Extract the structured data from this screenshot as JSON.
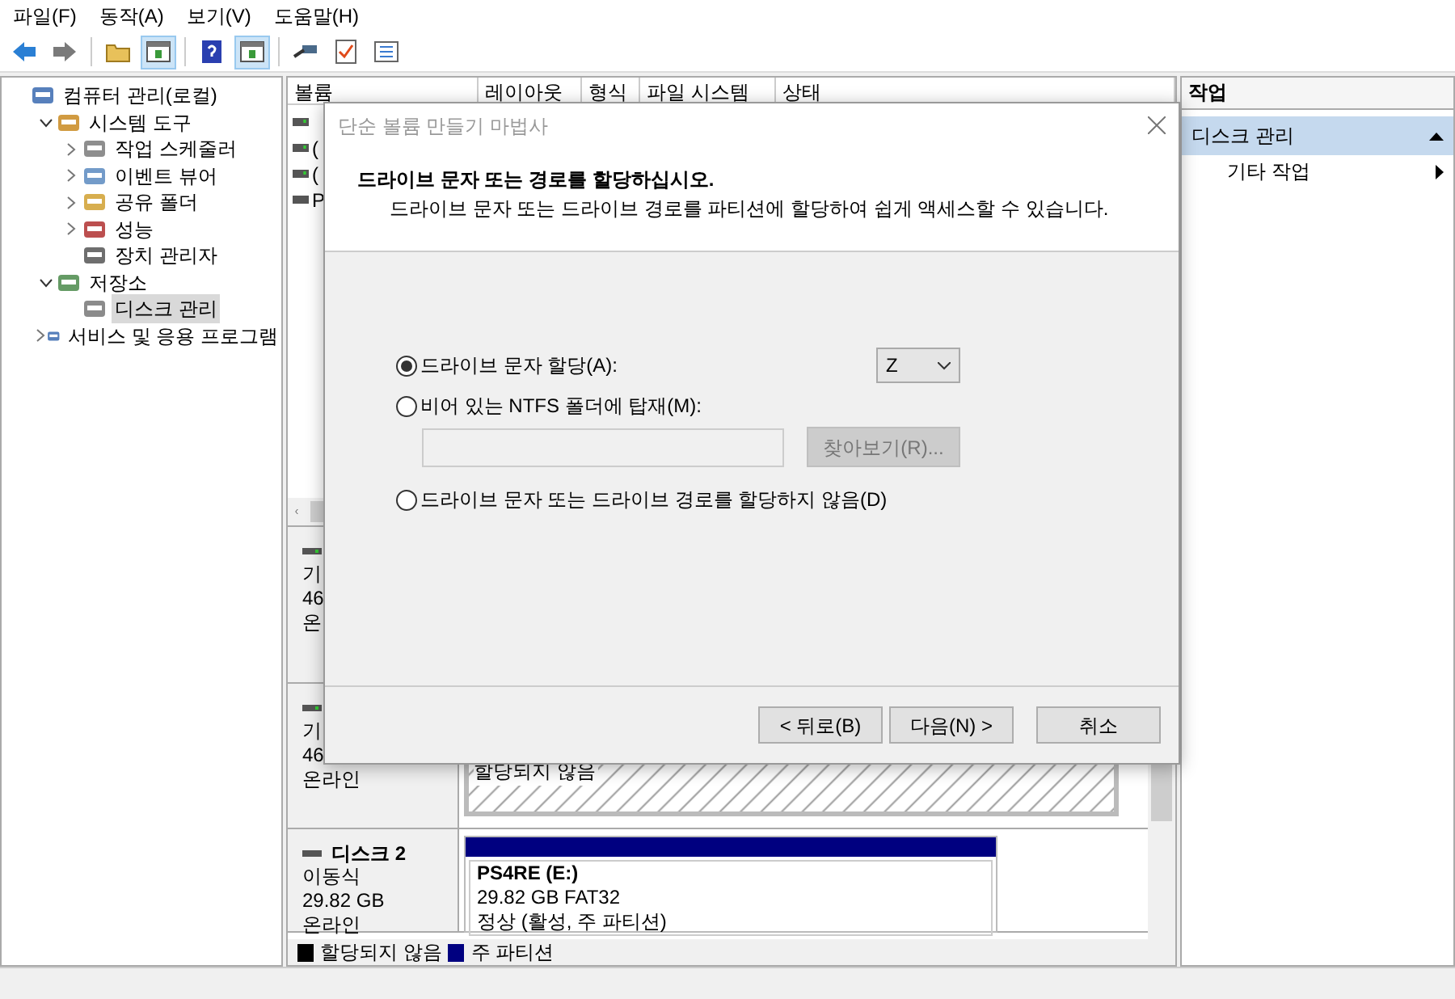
{
  "menu": [
    "파일(F)",
    "동작(A)",
    "보기(V)",
    "도움말(H)"
  ],
  "toolbar": [
    {
      "kind": "back",
      "pressed": false
    },
    {
      "kind": "forward",
      "pressed": false
    },
    {
      "kind": "sep"
    },
    {
      "kind": "folder",
      "pressed": false
    },
    {
      "kind": "pane",
      "pressed": true
    },
    {
      "kind": "sep"
    },
    {
      "kind": "help",
      "pressed": false
    },
    {
      "kind": "pane",
      "pressed": true
    },
    {
      "kind": "sep"
    },
    {
      "kind": "plug",
      "pressed": false
    },
    {
      "kind": "check",
      "pressed": false
    },
    {
      "kind": "list",
      "pressed": false
    }
  ],
  "tree": {
    "label": "컴퓨터 관리(로컬)",
    "children": [
      {
        "label": "시스템 도구",
        "expanded": true,
        "selected": false,
        "children": [
          {
            "label": "작업 스케줄러",
            "expanded": false,
            "selected": false
          },
          {
            "label": "이벤트 뷰어",
            "expanded": false,
            "selected": false
          },
          {
            "label": "공유 폴더",
            "expanded": false,
            "selected": false
          },
          {
            "label": "성능",
            "expanded": false,
            "selected": false
          },
          {
            "label": "장치 관리자",
            "selected": false
          }
        ]
      },
      {
        "label": "저장소",
        "expanded": true,
        "selected": false,
        "children": [
          {
            "label": "디스크 관리",
            "selected": true
          }
        ]
      },
      {
        "label": "서비스 및 응용 프로그램",
        "expanded": false,
        "selected": false
      }
    ]
  },
  "volume_table": {
    "columns": [
      "볼륨",
      "레이아웃",
      "형식",
      "파일 시스템",
      "상태"
    ],
    "rows": [
      {
        "column_1": ""
      },
      {
        "column_1": "("
      },
      {
        "column_1": "("
      },
      {
        "column_1": "P"
      }
    ]
  },
  "disks": [
    {
      "lines": [
        "기",
        "46",
        "온"
      ]
    },
    {
      "lines": [
        "기",
        "46",
        "온라인"
      ],
      "partitions": [
        {
          "kind": "unallocated",
          "lines": [
            "할당되지 않음"
          ]
        }
      ]
    },
    {
      "title": "디스크 2",
      "lines": [
        "이동식",
        "29.82 GB",
        "온라인"
      ],
      "partitions": [
        {
          "kind": "primary",
          "name": "PS4RE  (E:)",
          "lines": [
            "29.82 GB FAT32",
            "정상 (활성, 주 파티션)"
          ]
        }
      ]
    }
  ],
  "legend": [
    {
      "label": "할당되지 않음",
      "color": "#000000"
    },
    {
      "label": "주 파티션",
      "color": "#000080"
    }
  ],
  "actions": {
    "title": "작업",
    "section": "디스크 관리",
    "items": [
      "기타 작업"
    ]
  },
  "wizard": {
    "title": "단순 볼륨 만들기 마법사",
    "heading": "드라이브 문자 또는 경로를 할당하십시오.",
    "subheading": "드라이브 문자 또는 드라이브 경로를 파티션에 할당하여 쉽게 액세스할 수 있습니다.",
    "options": [
      {
        "kind": "letter",
        "label": "드라이브 문자 할당(A):",
        "selected": true,
        "value": "Z"
      },
      {
        "kind": "folder",
        "label": "비어 있는 NTFS 폴더에 탑재(M):",
        "selected": false,
        "browse": "찾아보기(R)...",
        "browse_disabled": true
      },
      {
        "kind": "none",
        "label": "드라이브 문자 또는 드라이브 경로를 할당하지 않음(D)",
        "selected": false
      }
    ],
    "buttons": [
      "< 뒤로(B)",
      "다음(N) >",
      "취소"
    ]
  }
}
